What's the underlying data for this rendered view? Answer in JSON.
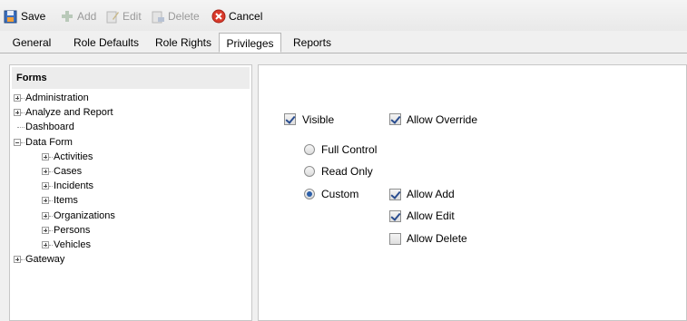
{
  "toolbar": {
    "save": {
      "label": "Save",
      "icon": "save-icon",
      "enabled": true
    },
    "add": {
      "label": "Add",
      "icon": "add-icon",
      "enabled": false
    },
    "edit": {
      "label": "Edit",
      "icon": "edit-icon",
      "enabled": false
    },
    "delete": {
      "label": "Delete",
      "icon": "delete-icon",
      "enabled": false
    },
    "cancel": {
      "label": "Cancel",
      "icon": "cancel-icon",
      "enabled": true
    }
  },
  "tabs": [
    {
      "label": "General",
      "active": false
    },
    {
      "label": "Role Defaults",
      "active": false
    },
    {
      "label": "Role Rights",
      "active": false
    },
    {
      "label": "Privileges",
      "active": true
    },
    {
      "label": "Reports",
      "active": false
    }
  ],
  "tree": {
    "header": "Forms",
    "nodes": [
      {
        "label": "Administration",
        "level": 0,
        "expander": "plus"
      },
      {
        "label": "Analyze and Report",
        "level": 0,
        "expander": "plus"
      },
      {
        "label": "Dashboard",
        "level": 0,
        "expander": "none"
      },
      {
        "label": "Data Form",
        "level": 0,
        "expander": "minus"
      },
      {
        "label": "Activities",
        "level": 1,
        "expander": "plus"
      },
      {
        "label": "Cases",
        "level": 1,
        "expander": "plus"
      },
      {
        "label": "Incidents",
        "level": 1,
        "expander": "plus",
        "selected": true
      },
      {
        "label": "Items",
        "level": 1,
        "expander": "plus"
      },
      {
        "label": "Organizations",
        "level": 1,
        "expander": "plus"
      },
      {
        "label": "Persons",
        "level": 1,
        "expander": "plus"
      },
      {
        "label": "Vehicles",
        "level": 1,
        "expander": "plus"
      },
      {
        "label": "Gateway",
        "level": 0,
        "expander": "plus"
      }
    ]
  },
  "privileges": {
    "visible": {
      "label": "Visible",
      "checked": true
    },
    "allow_override": {
      "label": "Allow Override",
      "checked": true
    },
    "access_options": [
      {
        "label": "Full Control",
        "selected": false
      },
      {
        "label": "Read Only",
        "selected": false
      },
      {
        "label": "Custom",
        "selected": true
      }
    ],
    "allow_add": {
      "label": "Allow Add",
      "checked": true
    },
    "allow_edit": {
      "label": "Allow Edit",
      "checked": true
    },
    "allow_delete": {
      "label": "Allow Delete",
      "checked": false
    }
  }
}
